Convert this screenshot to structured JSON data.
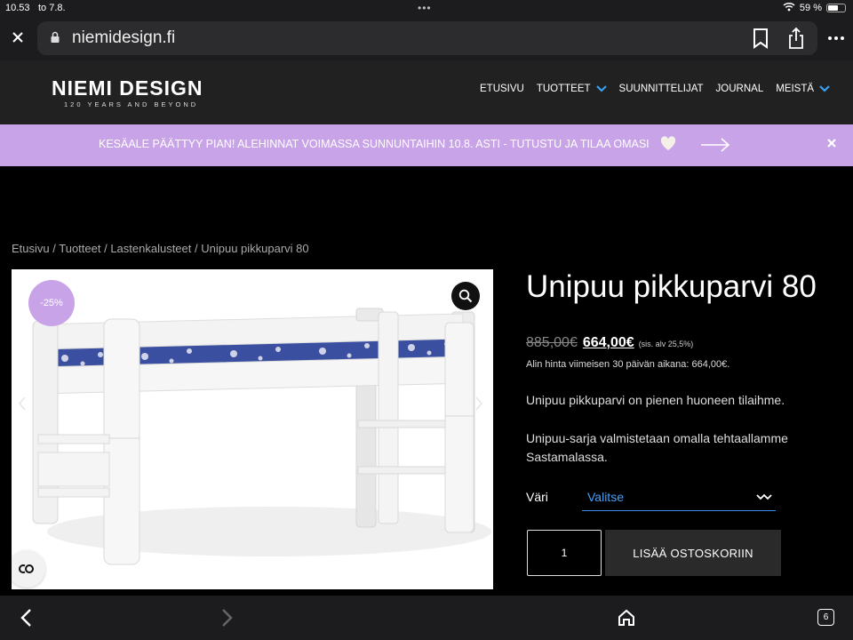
{
  "status_bar": {
    "time": "10.53",
    "date": "to 7.8.",
    "dots": "•••",
    "battery_percent": "59 %",
    "battery_level": 0.59
  },
  "browser": {
    "url": "niemidesign.fi",
    "tab_count": "6"
  },
  "site": {
    "logo_name": "NIEMI DESIGN",
    "logo_tagline": "120 YEARS AND BEYOND",
    "nav": [
      {
        "label": "ETUSIVU",
        "dropdown": false
      },
      {
        "label": "TUOTTEET",
        "dropdown": true
      },
      {
        "label": "SUUNNITTELIJAT",
        "dropdown": false
      },
      {
        "label": "JOURNAL",
        "dropdown": false
      },
      {
        "label": "MEISTÄ",
        "dropdown": true
      }
    ]
  },
  "banner": {
    "text": "KESÄALE PÄÄTTYY PIAN! ALEHINNAT VOIMASSA SUNNUNTAIHIN 10.8. ASTI - TUTUSTU JA TILAA OMASI",
    "color": "#c8a3e8"
  },
  "breadcrumb": [
    "Etusivu",
    "Tuotteet",
    "Lastenkalusteet",
    "Unipuu pikkuparvi 80"
  ],
  "breadcrumb_sep": " / ",
  "product": {
    "sale_badge": "-25%",
    "title": "Unipuu pikkuparvi 80",
    "old_price": "885,00€",
    "price": "664,00€",
    "vat_note": "(sis. alv 25,5%)",
    "lowest_price_note": "Alin hinta viimeisen 30 päivän aikana: 664,00€.",
    "description_1": "Unipuu pikkuparvi on pienen huoneen tilaihme.",
    "description_2": "Unipuu-sarja valmistetaan omalla tehtaallamme Sastamalassa.",
    "color_label": "Väri",
    "color_select": "Valitse",
    "quantity": "1",
    "add_to_cart": "LISÄÄ OSTOSKORIIN"
  },
  "colors": {
    "accent_blue": "#3a8ff0",
    "banner_purple": "#c8a3e8"
  }
}
